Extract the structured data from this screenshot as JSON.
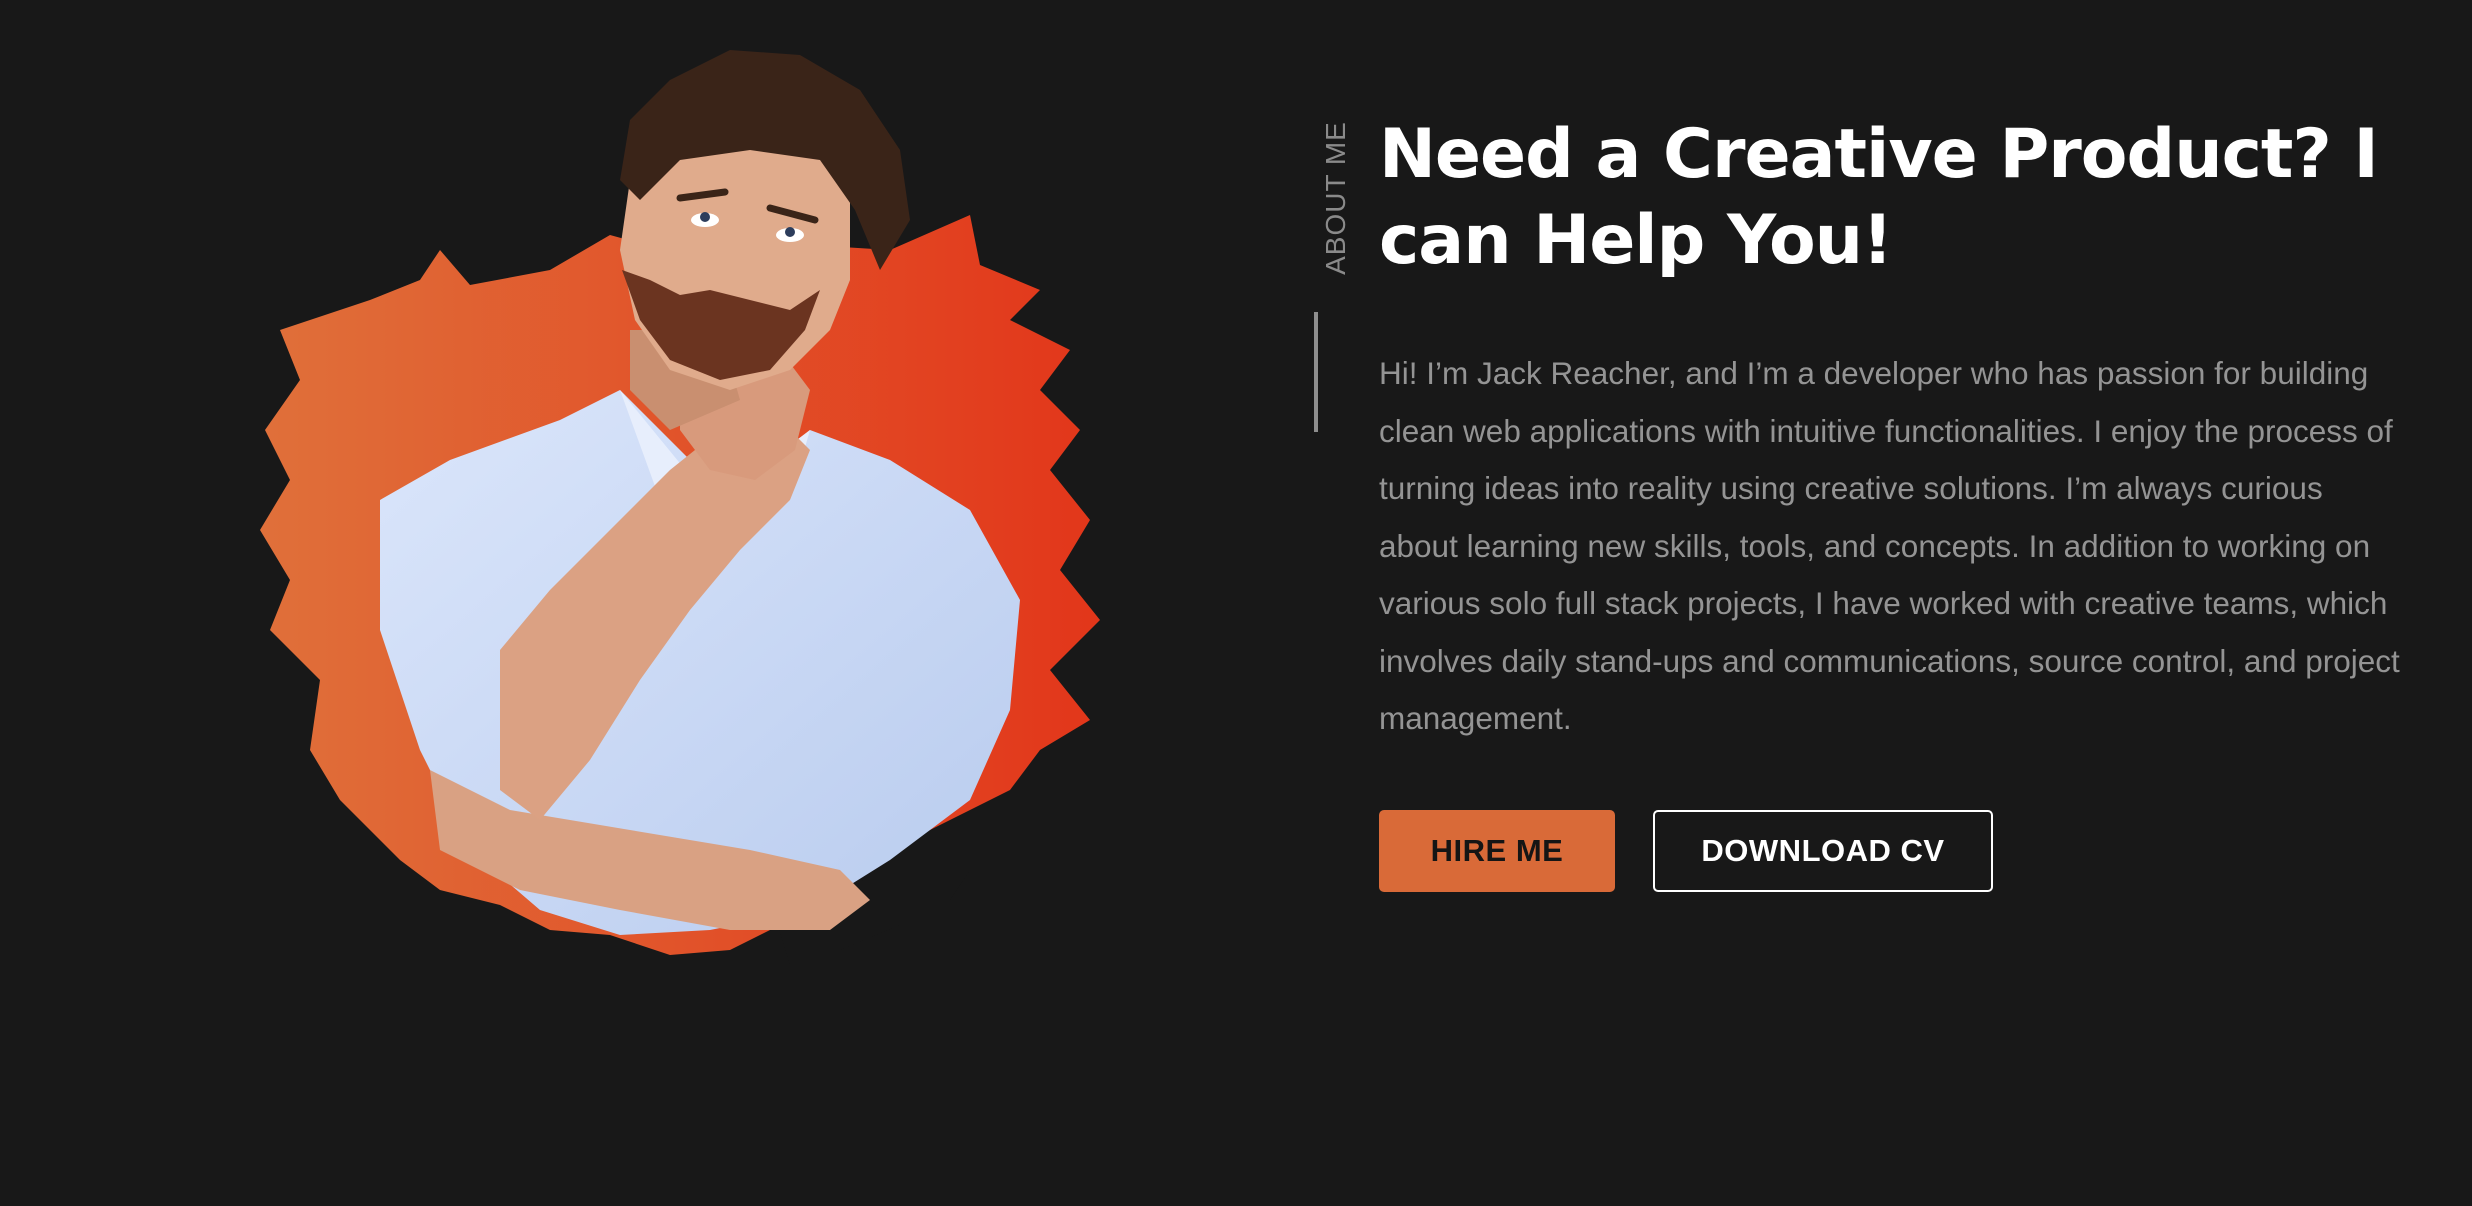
{
  "about": {
    "label": "ABOUT ME",
    "headline": "Need a Creative Product? I can Help You!",
    "bio": "Hi! I’m Jack Reacher, and I’m a developer who has passion for building clean web applications with intuitive functionalities. I enjoy the process of turning ideas into reality using creative solutions. I’m always curious about learning new skills, tools, and concepts. In addition to working on various solo full stack projects, I have worked with creative teams, which involves daily stand-ups and communications, source control, and project management."
  },
  "buttons": {
    "hire_label": "HIRE ME",
    "cv_label": "DOWNLOAD CV"
  },
  "theme": {
    "background": "#181818",
    "accent": "#d96a38",
    "splash_from": "#e16a35",
    "splash_to": "#e2351a",
    "shirt": "#c9d9f5"
  },
  "icons": {
    "hero_image": "thinking-man-portrait-with-orange-paint-splash"
  }
}
